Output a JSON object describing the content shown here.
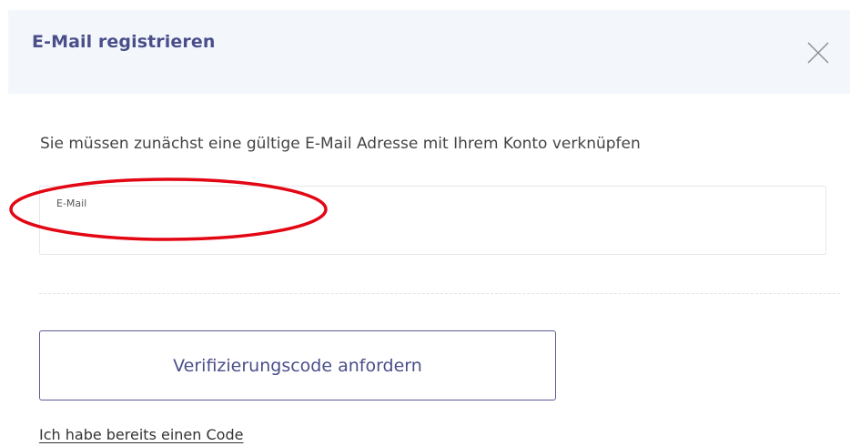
{
  "dialog": {
    "title": "E-Mail registrieren",
    "intro_text": "Sie müssen zunächst eine gültige E-Mail Adresse mit Ihrem Konto verknüpfen"
  },
  "email_field": {
    "label": "E-Mail",
    "value": ""
  },
  "actions": {
    "request_code_label": "Verifizierungscode anfordern",
    "have_code_link": "Ich habe bereits einen Code"
  },
  "colors": {
    "header_background": "#f3f7fc",
    "accent": "#4a4f8a",
    "annotation": "#e30613"
  },
  "icons": {
    "close": "close-icon"
  }
}
